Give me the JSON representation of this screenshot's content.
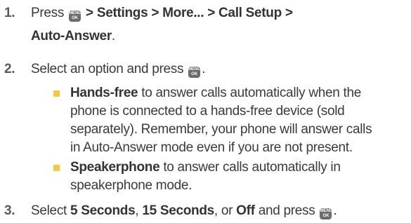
{
  "steps": [
    {
      "number": "1.",
      "line1_prefix": "Press",
      "line1_path": "> Settings > More... > Call Setup >",
      "line2_bold": "Auto-Answer",
      "line2_suffix": "."
    },
    {
      "number": "2.",
      "text": "Select an option and press",
      "suffix": "."
    },
    {
      "number": "3.",
      "prefix": "Select",
      "opt1": "5 Seconds",
      "sep1": ",",
      "opt2": "15 Seconds",
      "sep2": ", or",
      "opt3": "Off",
      "mid": "and press",
      "suffix": "."
    }
  ],
  "bullets": [
    {
      "bold": "Hands-free",
      "line1": "to answer calls automatically when the",
      "lines": [
        "phone is connected to a hands-free device (sold",
        "separately). Remember, your phone will answer calls",
        "in Auto-Answer mode even if you are not present."
      ]
    },
    {
      "bold": "Speakerphone",
      "line1": "to answer calls automatically in",
      "lines": [
        "speakerphone mode."
      ]
    }
  ],
  "key": {
    "top": "MENU",
    "bottom": "OK",
    "icon": "menu-ok-key-icon"
  },
  "colors": {
    "text": "#3a3a3a",
    "key": "#6b6b6b",
    "bullet": "#f4c842"
  }
}
